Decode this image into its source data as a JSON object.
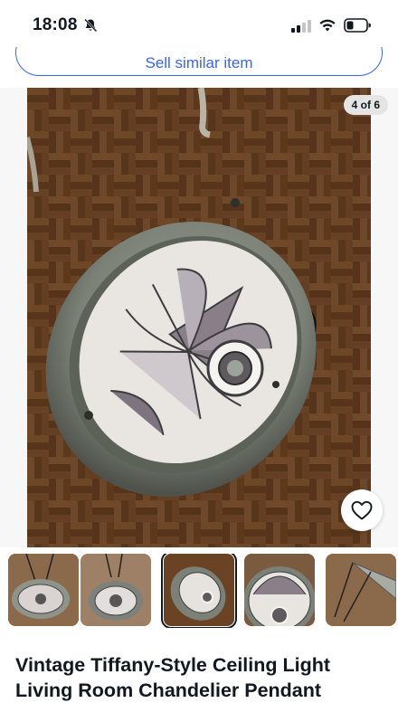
{
  "status_bar": {
    "time": "18:08",
    "icons": [
      "bell-slash-icon",
      "signal-icon",
      "wifi-icon",
      "battery-icon"
    ]
  },
  "actions": {
    "sell_similar_label": "Sell similar item"
  },
  "gallery": {
    "counter": "4 of 6",
    "current_index": 4,
    "total": 6
  },
  "thumbnails": [
    {
      "label": "thumbnail 1"
    },
    {
      "label": "thumbnail 2"
    },
    {
      "label": "thumbnail 3",
      "selected": true
    },
    {
      "label": "thumbnail 4"
    },
    {
      "label": "thumbnail 5"
    }
  ],
  "listing": {
    "title": "Vintage Tiffany-Style Ceiling Light Living Room Chandelier Pendant"
  },
  "colors": {
    "accent": "#3665f3",
    "text": "#111820"
  }
}
